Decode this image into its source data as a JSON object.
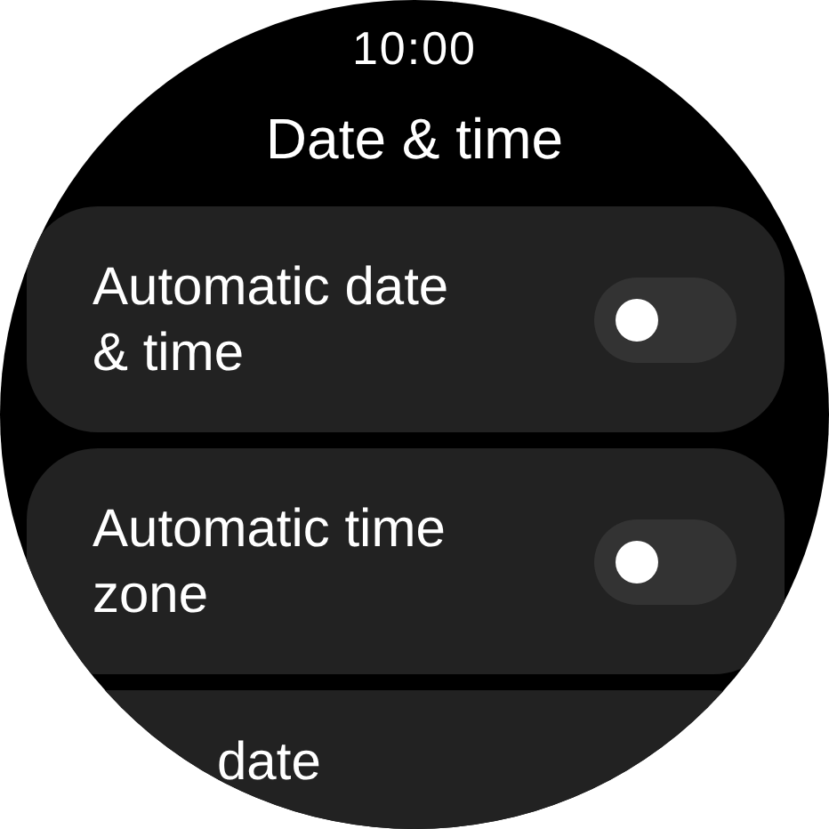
{
  "status_bar": {
    "time": "10:00"
  },
  "title": "Date & time",
  "items": [
    {
      "kind": "toggle",
      "label": "Automatic date & time",
      "on": false
    },
    {
      "kind": "toggle",
      "label": "Automatic time zone",
      "on": false
    },
    {
      "kind": "link",
      "label": "date"
    }
  ]
}
